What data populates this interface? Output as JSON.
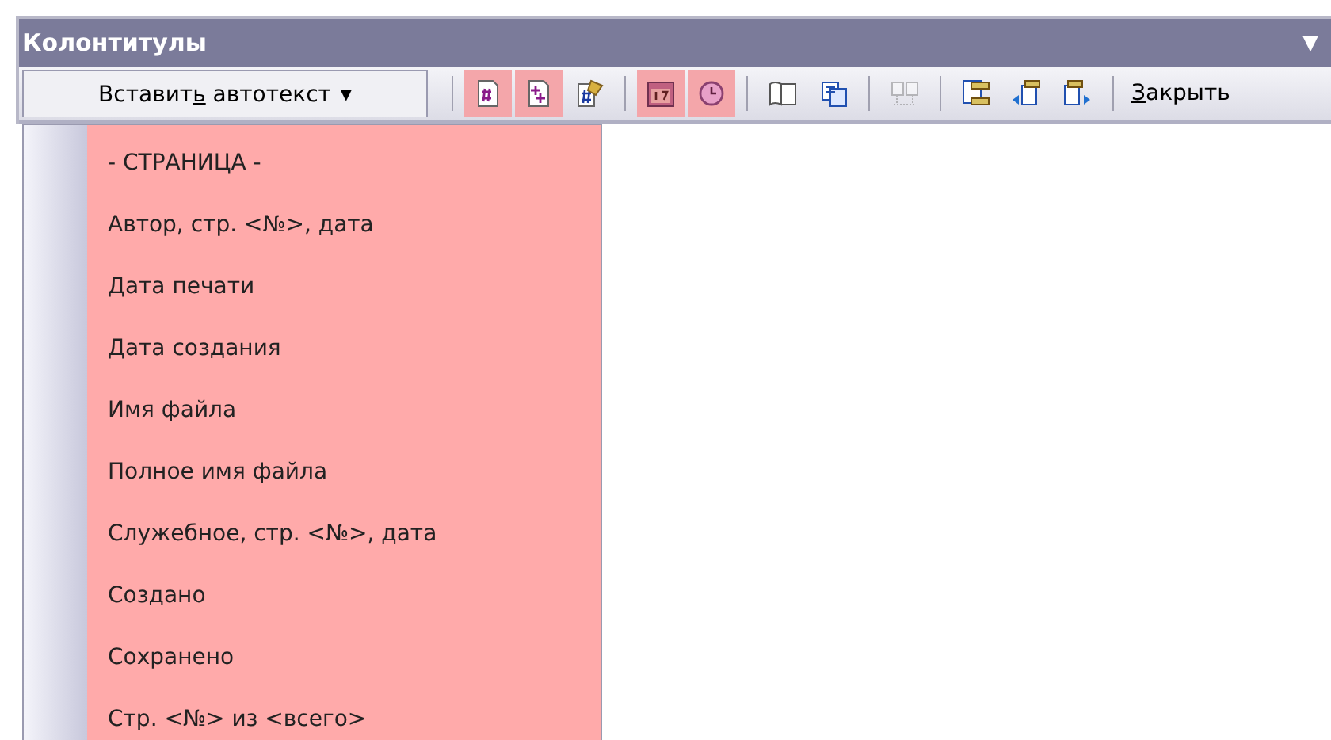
{
  "window": {
    "title": "Колонтитулы",
    "menu_glyph": "▼"
  },
  "toolbar": {
    "autotext_button": {
      "before": "Вставит",
      "key": "ь",
      "after": " автотекст",
      "caret": "▾",
      "expanded": true
    },
    "tools": [
      {
        "kind": "hash-page",
        "highlighted": true,
        "disabled": false
      },
      {
        "kind": "plus-page",
        "highlighted": true,
        "disabled": false
      },
      {
        "kind": "format-page",
        "highlighted": false,
        "disabled": false
      },
      {
        "kind": "separator"
      },
      {
        "kind": "calendar",
        "highlighted": true,
        "disabled": false
      },
      {
        "kind": "clock",
        "highlighted": true,
        "disabled": false
      },
      {
        "kind": "separator"
      },
      {
        "kind": "book",
        "highlighted": false,
        "disabled": false
      },
      {
        "kind": "pages",
        "highlighted": false,
        "disabled": false
      },
      {
        "kind": "separator"
      },
      {
        "kind": "link",
        "highlighted": false,
        "disabled": true
      },
      {
        "kind": "separator"
      },
      {
        "kind": "switch",
        "highlighted": false,
        "disabled": false
      },
      {
        "kind": "prev",
        "highlighted": false,
        "disabled": false
      },
      {
        "kind": "next",
        "highlighted": false,
        "disabled": false
      },
      {
        "kind": "separator"
      }
    ],
    "close_button": {
      "key": "З",
      "after": "акрыть"
    }
  },
  "menu": {
    "items": [
      {
        "label": "- СТРАНИЦА -",
        "highlighted": true
      },
      {
        "label": "Автор, стр. <№>, дата",
        "highlighted": true
      },
      {
        "label": "Дата печати",
        "highlighted": true
      },
      {
        "label": "Дата создания",
        "highlighted": true
      },
      {
        "label": "Имя файла",
        "highlighted": true
      },
      {
        "label": "Полное имя файла",
        "highlighted": true
      },
      {
        "label": "Служебное, стр. <№>, дата",
        "highlighted": true
      },
      {
        "label": "Создано",
        "highlighted": true
      },
      {
        "label": "Сохранено",
        "highlighted": true
      },
      {
        "label": "Стр. <№> из <всего>",
        "highlighted": true
      }
    ]
  }
}
